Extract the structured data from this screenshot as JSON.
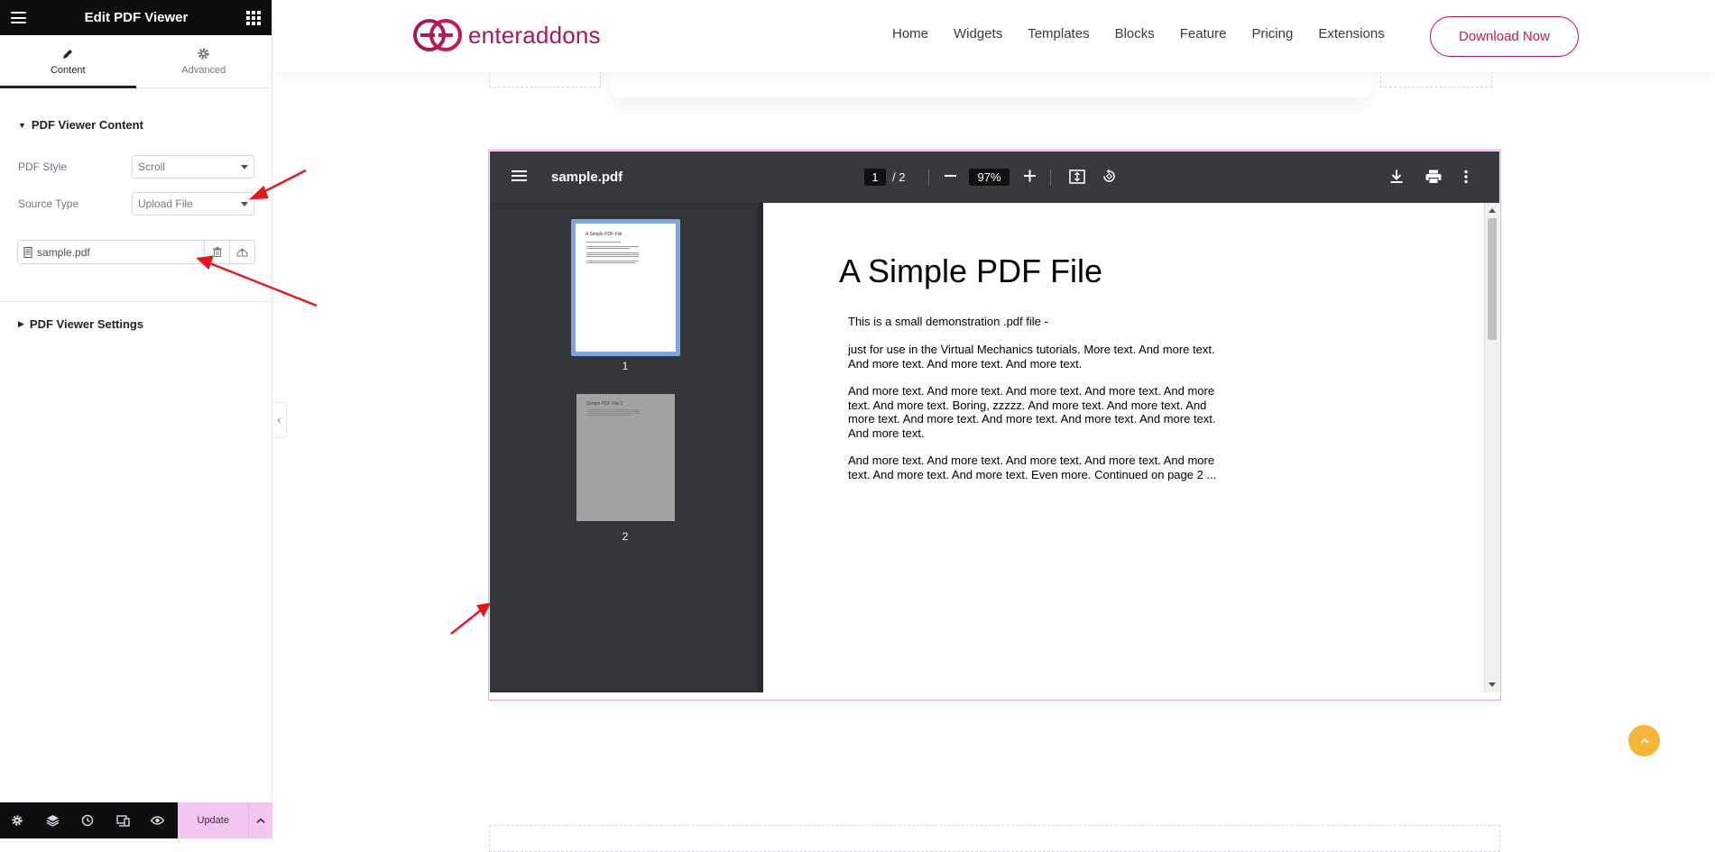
{
  "panel": {
    "title": "Edit PDF Viewer",
    "tabs": [
      {
        "label": "Content",
        "icon": "pencil-icon",
        "active": true
      },
      {
        "label": "Advanced",
        "icon": "gear-icon",
        "active": false
      }
    ],
    "content_section": {
      "title": "PDF Viewer Content",
      "pdf_style_label": "PDF Style",
      "pdf_style_value": "Scroll",
      "source_type_label": "Source Type",
      "source_type_value": "Upload File",
      "file_name": "sample.pdf"
    },
    "settings_section": {
      "title": "PDF Viewer Settings"
    },
    "footer": {
      "icons": [
        "gear-icon",
        "layers-icon",
        "history-icon",
        "responsive-icon",
        "eye-icon"
      ],
      "update_label": "Update"
    }
  },
  "site": {
    "logo_text": "enteraddons",
    "brand_color": "#a8185f",
    "nav": [
      "Home",
      "Widgets",
      "Templates",
      "Blocks",
      "Feature",
      "Pricing",
      "Extensions"
    ],
    "download_label": "Download Now"
  },
  "pdf": {
    "file_name": "sample.pdf",
    "current_page": "1",
    "page_total": "/ 2",
    "zoom": "97%",
    "thumbnails": [
      {
        "label": "1",
        "title": "A Simple PDF File",
        "selected": true
      },
      {
        "label": "2",
        "title": "Simple PDF File 2",
        "selected": false
      }
    ],
    "document": {
      "title": "A Simple PDF File",
      "paragraphs": [
        "This is a small demonstration .pdf file -",
        "just for use in the Virtual Mechanics tutorials. More text. And more text. And more text. And more text. And more text.",
        "And more text. And more text. And more text. And more text. And more text. And more text. Boring, zzzzz. And more text. And more text. And more text. And more text. And more text. And more text. And more text. And more text.",
        "And more text. And more text. And more text. And more text. And more text. And more text. And more text. Even more. Continued on page 2 ..."
      ]
    }
  },
  "colors": {
    "panel_header": "#0c0d0e",
    "update_button": "#f3c6f2",
    "viewer_toolbar": "#38383d",
    "viewer_sidebar": "#323639",
    "widget_outline": "#ee9fe9",
    "scroll_top_button": "#f7b538",
    "annotation_arrow": "#e8151b"
  }
}
